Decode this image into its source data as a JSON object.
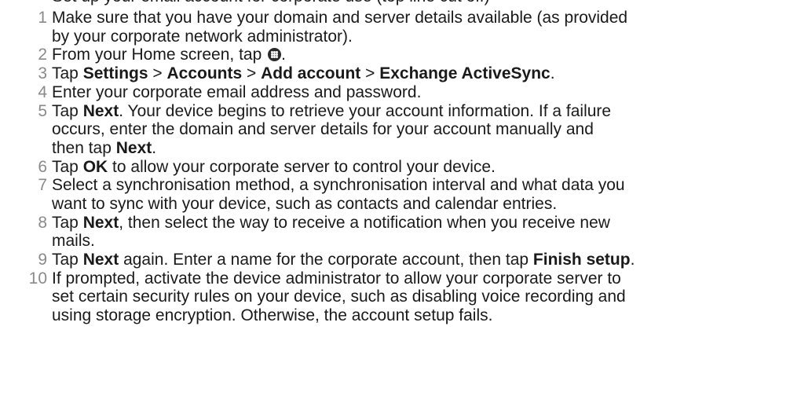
{
  "partial_line_above": "Set up your email account for corporate use (top line cut off)",
  "steps": [
    {
      "number": "1",
      "lines": [
        [
          {
            "t": "Make sure that you have your domain and server details available (as provided"
          }
        ],
        [
          {
            "t": "by your corporate network administrator)."
          }
        ]
      ]
    },
    {
      "number": "2",
      "lines": [
        [
          {
            "t": "From your Home screen, tap "
          },
          {
            "icon": "apps-icon"
          },
          {
            "t": "."
          }
        ]
      ]
    },
    {
      "number": "3",
      "lines": [
        [
          {
            "t": "Tap "
          },
          {
            "b": "Settings"
          },
          {
            "t": " > "
          },
          {
            "b": "Accounts"
          },
          {
            "t": " > "
          },
          {
            "b": "Add account"
          },
          {
            "t": " > "
          },
          {
            "b": "Exchange ActiveSync"
          },
          {
            "t": "."
          }
        ]
      ]
    },
    {
      "number": "4",
      "lines": [
        [
          {
            "t": "Enter your corporate email address and password."
          }
        ]
      ]
    },
    {
      "number": "5",
      "lines": [
        [
          {
            "t": "Tap "
          },
          {
            "b": "Next"
          },
          {
            "t": ". Your device begins to retrieve your account information. If a failure"
          }
        ],
        [
          {
            "t": "occurs, enter the domain and server details for your account manually and"
          }
        ],
        [
          {
            "t": "then tap "
          },
          {
            "b": "Next"
          },
          {
            "t": "."
          }
        ]
      ]
    },
    {
      "number": "6",
      "lines": [
        [
          {
            "t": "Tap "
          },
          {
            "b": "OK"
          },
          {
            "t": " to allow your corporate server to control your device."
          }
        ]
      ]
    },
    {
      "number": "7",
      "lines": [
        [
          {
            "t": "Select a synchronisation method, a synchronisation interval and what data you"
          }
        ],
        [
          {
            "t": "want to sync with your device, such as contacts and calendar entries."
          }
        ]
      ]
    },
    {
      "number": "8",
      "lines": [
        [
          {
            "t": "Tap "
          },
          {
            "b": "Next"
          },
          {
            "t": ", then select the way to receive a notification when you receive new"
          }
        ],
        [
          {
            "t": "mails."
          }
        ]
      ]
    },
    {
      "number": "9",
      "lines": [
        [
          {
            "t": "Tap "
          },
          {
            "b": "Next"
          },
          {
            "t": " again. Enter a name for the corporate account, then tap "
          },
          {
            "b": "Finish setup"
          },
          {
            "t": "."
          }
        ]
      ]
    },
    {
      "number": "10",
      "lines": [
        [
          {
            "t": "If prompted, activate the device administrator to allow your corporate server to"
          }
        ],
        [
          {
            "t": "set certain security rules on your device, such as disabling voice recording and"
          }
        ],
        [
          {
            "t": "using storage encryption. Otherwise, the account setup fails."
          }
        ]
      ]
    }
  ]
}
